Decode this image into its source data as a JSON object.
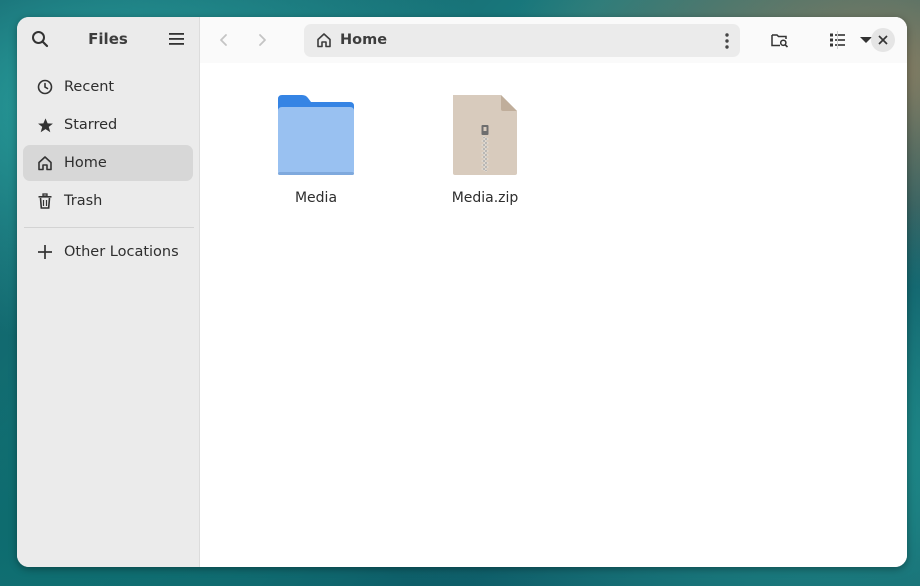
{
  "window": {
    "app_title": "Files"
  },
  "sidebar": {
    "items": [
      {
        "label": "Recent",
        "icon": "clock-icon"
      },
      {
        "label": "Starred",
        "icon": "star-icon"
      },
      {
        "label": "Home",
        "icon": "home-icon",
        "active": true
      },
      {
        "label": "Trash",
        "icon": "trash-icon"
      }
    ],
    "other_locations": {
      "label": "Other Locations",
      "icon": "plus-icon"
    }
  },
  "toolbar": {
    "path_label": "Home",
    "icons": [
      "back-icon",
      "forward-icon",
      "kebab-menu-icon",
      "folder-search-icon",
      "list-view-icon",
      "chevron-down-icon",
      "close-icon"
    ]
  },
  "files": [
    {
      "name": "Media",
      "type": "folder"
    },
    {
      "name": "Media.zip",
      "type": "zip-archive"
    }
  ],
  "colors": {
    "folder_front": "#99c1f1",
    "folder_back": "#3584e4",
    "zip_body": "#d8cbbd",
    "active_item": "#d7d7d7"
  }
}
